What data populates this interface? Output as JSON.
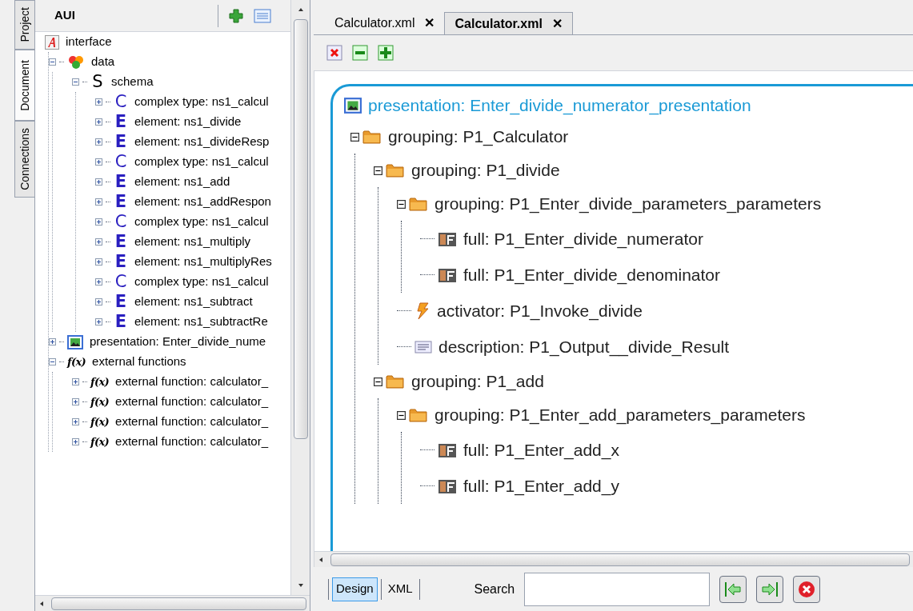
{
  "side_tabs": [
    {
      "label": "Project",
      "selected": false
    },
    {
      "label": "Document",
      "selected": true
    },
    {
      "label": "Connections",
      "selected": false
    }
  ],
  "panel_title": "AUI",
  "tree": [
    {
      "kind": "interface",
      "label": "interface",
      "children": [
        {
          "kind": "data",
          "label": "data",
          "expanded": true,
          "children": [
            {
              "kind": "schema",
              "badge": "S",
              "label": "schema",
              "expanded": true,
              "children": [
                {
                  "kind": "complex",
                  "badge": "C",
                  "label": "complex type: ns1_calcul",
                  "expanded": false
                },
                {
                  "kind": "element",
                  "badge": "E",
                  "label": "element: ns1_divide",
                  "expanded": false
                },
                {
                  "kind": "element",
                  "badge": "E",
                  "label": "element: ns1_divideResp",
                  "expanded": false
                },
                {
                  "kind": "complex",
                  "badge": "C",
                  "label": "complex type: ns1_calcul",
                  "expanded": false
                },
                {
                  "kind": "element",
                  "badge": "E",
                  "label": "element: ns1_add",
                  "expanded": false
                },
                {
                  "kind": "element",
                  "badge": "E",
                  "label": "element: ns1_addRespon",
                  "expanded": false
                },
                {
                  "kind": "complex",
                  "badge": "C",
                  "label": "complex type: ns1_calcul",
                  "expanded": false
                },
                {
                  "kind": "element",
                  "badge": "E",
                  "label": "element: ns1_multiply",
                  "expanded": false
                },
                {
                  "kind": "element",
                  "badge": "E",
                  "label": "element: ns1_multiplyRes",
                  "expanded": false
                },
                {
                  "kind": "complex",
                  "badge": "C",
                  "label": "complex type: ns1_calcul",
                  "expanded": false
                },
                {
                  "kind": "element",
                  "badge": "E",
                  "label": "element: ns1_subtract",
                  "expanded": false
                },
                {
                  "kind": "element",
                  "badge": "E",
                  "label": "element: ns1_subtractRe",
                  "expanded": false
                }
              ]
            }
          ]
        },
        {
          "kind": "presentation",
          "label": "presentation: Enter_divide_nume",
          "expanded": false
        },
        {
          "kind": "function",
          "badge": "f(x)",
          "label": "external functions",
          "expanded": true,
          "children": [
            {
              "kind": "function",
              "badge": "f(x)",
              "label": "external function: calculator_",
              "expanded": false
            },
            {
              "kind": "function",
              "badge": "f(x)",
              "label": "external function: calculator_",
              "expanded": false
            },
            {
              "kind": "function",
              "badge": "f(x)",
              "label": "external function: calculator_",
              "expanded": false
            },
            {
              "kind": "function",
              "badge": "f(x)",
              "label": "external function: calculator_",
              "expanded": false
            }
          ]
        }
      ]
    }
  ],
  "editor_tabs": [
    {
      "label": "Calculator.xml",
      "close": "✕",
      "selected": false
    },
    {
      "label": "Calculator.xml",
      "close": "✕",
      "selected": true
    }
  ],
  "design": {
    "kind": "presentation",
    "label": "presentation: Enter_divide_numerator_presentation",
    "children": [
      {
        "kind": "grouping",
        "label": "grouping: P1_Calculator",
        "expanded": true,
        "children": [
          {
            "kind": "grouping",
            "label": "grouping: P1_divide",
            "expanded": true,
            "children": [
              {
                "kind": "grouping",
                "label": "grouping: P1_Enter_divide_parameters_parameters",
                "expanded": true,
                "children": [
                  {
                    "kind": "full",
                    "label": "full: P1_Enter_divide_numerator"
                  },
                  {
                    "kind": "full",
                    "label": "full: P1_Enter_divide_denominator"
                  }
                ]
              },
              {
                "kind": "activator",
                "label": "activator: P1_Invoke_divide"
              },
              {
                "kind": "description",
                "label": "description: P1_Output__divide_Result"
              }
            ]
          },
          {
            "kind": "grouping",
            "label": "grouping: P1_add",
            "expanded": true,
            "children": [
              {
                "kind": "grouping",
                "label": "grouping: P1_Enter_add_parameters_parameters",
                "expanded": true,
                "children": [
                  {
                    "kind": "full",
                    "label": "full: P1_Enter_add_x"
                  },
                  {
                    "kind": "full",
                    "label": "full: P1_Enter_add_y"
                  }
                ]
              }
            ]
          }
        ]
      }
    ]
  },
  "view_tabs": [
    {
      "label": "Design",
      "selected": true
    },
    {
      "label": "XML",
      "selected": false
    }
  ],
  "search": {
    "label": "Search"
  }
}
